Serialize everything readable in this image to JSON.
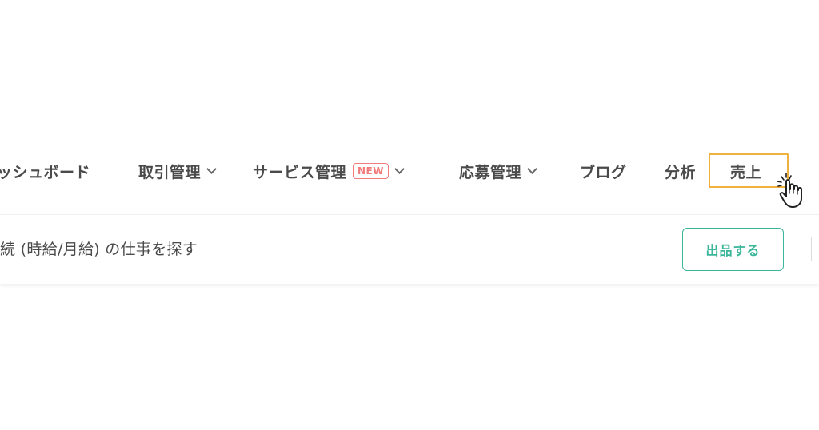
{
  "nav": {
    "items": [
      {
        "label": "ッシュボード"
      },
      {
        "label": "取引管理"
      },
      {
        "label": "サービス管理",
        "badge": "NEW"
      },
      {
        "label": "応募管理"
      },
      {
        "label": "ブログ"
      },
      {
        "label": "分析"
      },
      {
        "label": "売上"
      }
    ]
  },
  "subbar": {
    "search_text": "続 (時給/月給) の仕事を探す",
    "list_button": "出品する"
  },
  "colors": {
    "highlight": "#f0b13f",
    "accent": "#3bb69a",
    "badge": "#f07b7b"
  }
}
